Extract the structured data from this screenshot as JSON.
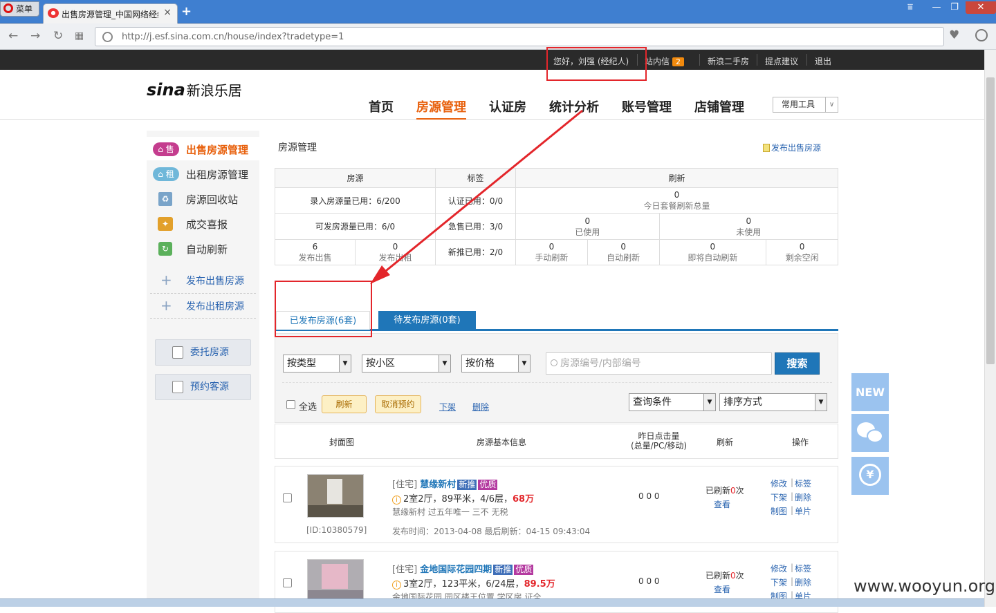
{
  "browser": {
    "menu_label": "菜单",
    "tab_title": "出售房源管理_中国网络经纪",
    "tab_close": "×",
    "new_tab": "+",
    "url": "http://j.esf.sina.com.cn/house/index?tradetype=1",
    "win_buttons": [
      "⩸",
      "—",
      "❐",
      "✕"
    ]
  },
  "topbar": {
    "greeting": "您好，刘强 (经纪人)",
    "messages_label": "站内信",
    "messages_count": "2",
    "links": [
      "新浪二手房",
      "提点建议",
      "退出"
    ]
  },
  "header": {
    "logo_en": "sina",
    "logo_cn": "新浪乐居",
    "nav": [
      "首页",
      "房源管理",
      "认证房",
      "统计分析",
      "账号管理",
      "店铺管理"
    ],
    "active_nav": "房源管理",
    "tools_label": "常用工具",
    "tools_arrow": "∨"
  },
  "sidebar": {
    "items": [
      {
        "badge": "售",
        "label": "出售房源管理"
      },
      {
        "badge": "租",
        "label": "出租房源管理"
      },
      {
        "label": "房源回收站"
      },
      {
        "label": "成交喜报"
      },
      {
        "label": "自动刷新"
      }
    ],
    "links": [
      "发布出售房源",
      "发布出租房源"
    ],
    "plus": "+",
    "buttons": [
      "委托房源",
      "预约客源"
    ]
  },
  "panel": {
    "title": "房源管理",
    "publish_link": "发布出售房源"
  },
  "stats": {
    "head": [
      "房源",
      "标签",
      "刷新"
    ],
    "row1_left": "录入房源量已用：6/200",
    "row1_mid": "认证已用：0/0",
    "row1_right_num": "0",
    "row1_right_cap": "今日套餐刷新总量",
    "row2_left": "可发房源量已用：6/0",
    "row2_mid": "急售已用：3/0",
    "row2_r1_num": "0",
    "row2_r1_cap": "已使用",
    "row2_r2_num": "0",
    "row2_r2_cap": "未使用",
    "row3_a_num": "6",
    "row3_a_cap": "发布出售",
    "row3_b_num": "0",
    "row3_b_cap": "发布出租",
    "row3_mid": "新推已用：2/0",
    "row3_c": [
      {
        "num": "0",
        "cap": "手动刷新"
      },
      {
        "num": "0",
        "cap": "自动刷新"
      },
      {
        "num": "0",
        "cap": "即将自动刷新"
      },
      {
        "num": "0",
        "cap": "剩余空闲"
      }
    ]
  },
  "tabs": {
    "published": "已发布房源(6套)",
    "pending": "待发布房源(0套)"
  },
  "filters": {
    "type": "按类型",
    "community": "按小区",
    "price": "按价格",
    "search_placeholder": "房源编号/内部编号",
    "search_button": "搜索",
    "select_all": "全选",
    "refresh": "刷新",
    "cancel_booking": "取消预约",
    "offline": "下架",
    "delete": "删除",
    "query": "查询条件",
    "sort": "排序方式",
    "dropdown_arrow": "▼"
  },
  "list_header": {
    "cover": "封面图",
    "info": "房源基本信息",
    "clicks_line1": "昨日点击量",
    "clicks_line2": "(总量/PC/移动)",
    "refresh": "刷新",
    "actions": "操作"
  },
  "listings": [
    {
      "id": "[ID:10380579]",
      "type": "[住宅]",
      "name": "慧缘新村",
      "tag1": "新推",
      "tag2": "优质",
      "layout": "2室2厅，89平米，4/6层，",
      "price": "68万",
      "desc": "慧缘新村 过五年唯一 三不 无税",
      "times": "发布时间：2013-04-08   最后刷新：04-15 09:43:04",
      "clicks": "0  0  0",
      "refreshed_prefix": "已刷新",
      "refreshed_count": "0",
      "refreshed_suffix": "次",
      "view": "查看",
      "ops": [
        "修改",
        "标签",
        "下架",
        "删除",
        "制图",
        "单片"
      ]
    },
    {
      "type": "[住宅]",
      "name": "金地国际花园四期",
      "tag1": "新推",
      "tag2": "优质",
      "layout": "3室2厅，123平米，6/24层，",
      "price": "89.5万",
      "desc": "金地国际花园 园区楼王位置 学区房 证全",
      "clicks": "0  0  0",
      "refreshed_prefix": "已刷新",
      "refreshed_count": "0",
      "refreshed_suffix": "次",
      "view": "查看",
      "ops": [
        "修改",
        "标签",
        "下架",
        "删除",
        "制图",
        "单片"
      ]
    }
  ],
  "floating": {
    "new_label": "NEW",
    "cal_symbol": "¥"
  },
  "watermark": "www.wooyun.org"
}
